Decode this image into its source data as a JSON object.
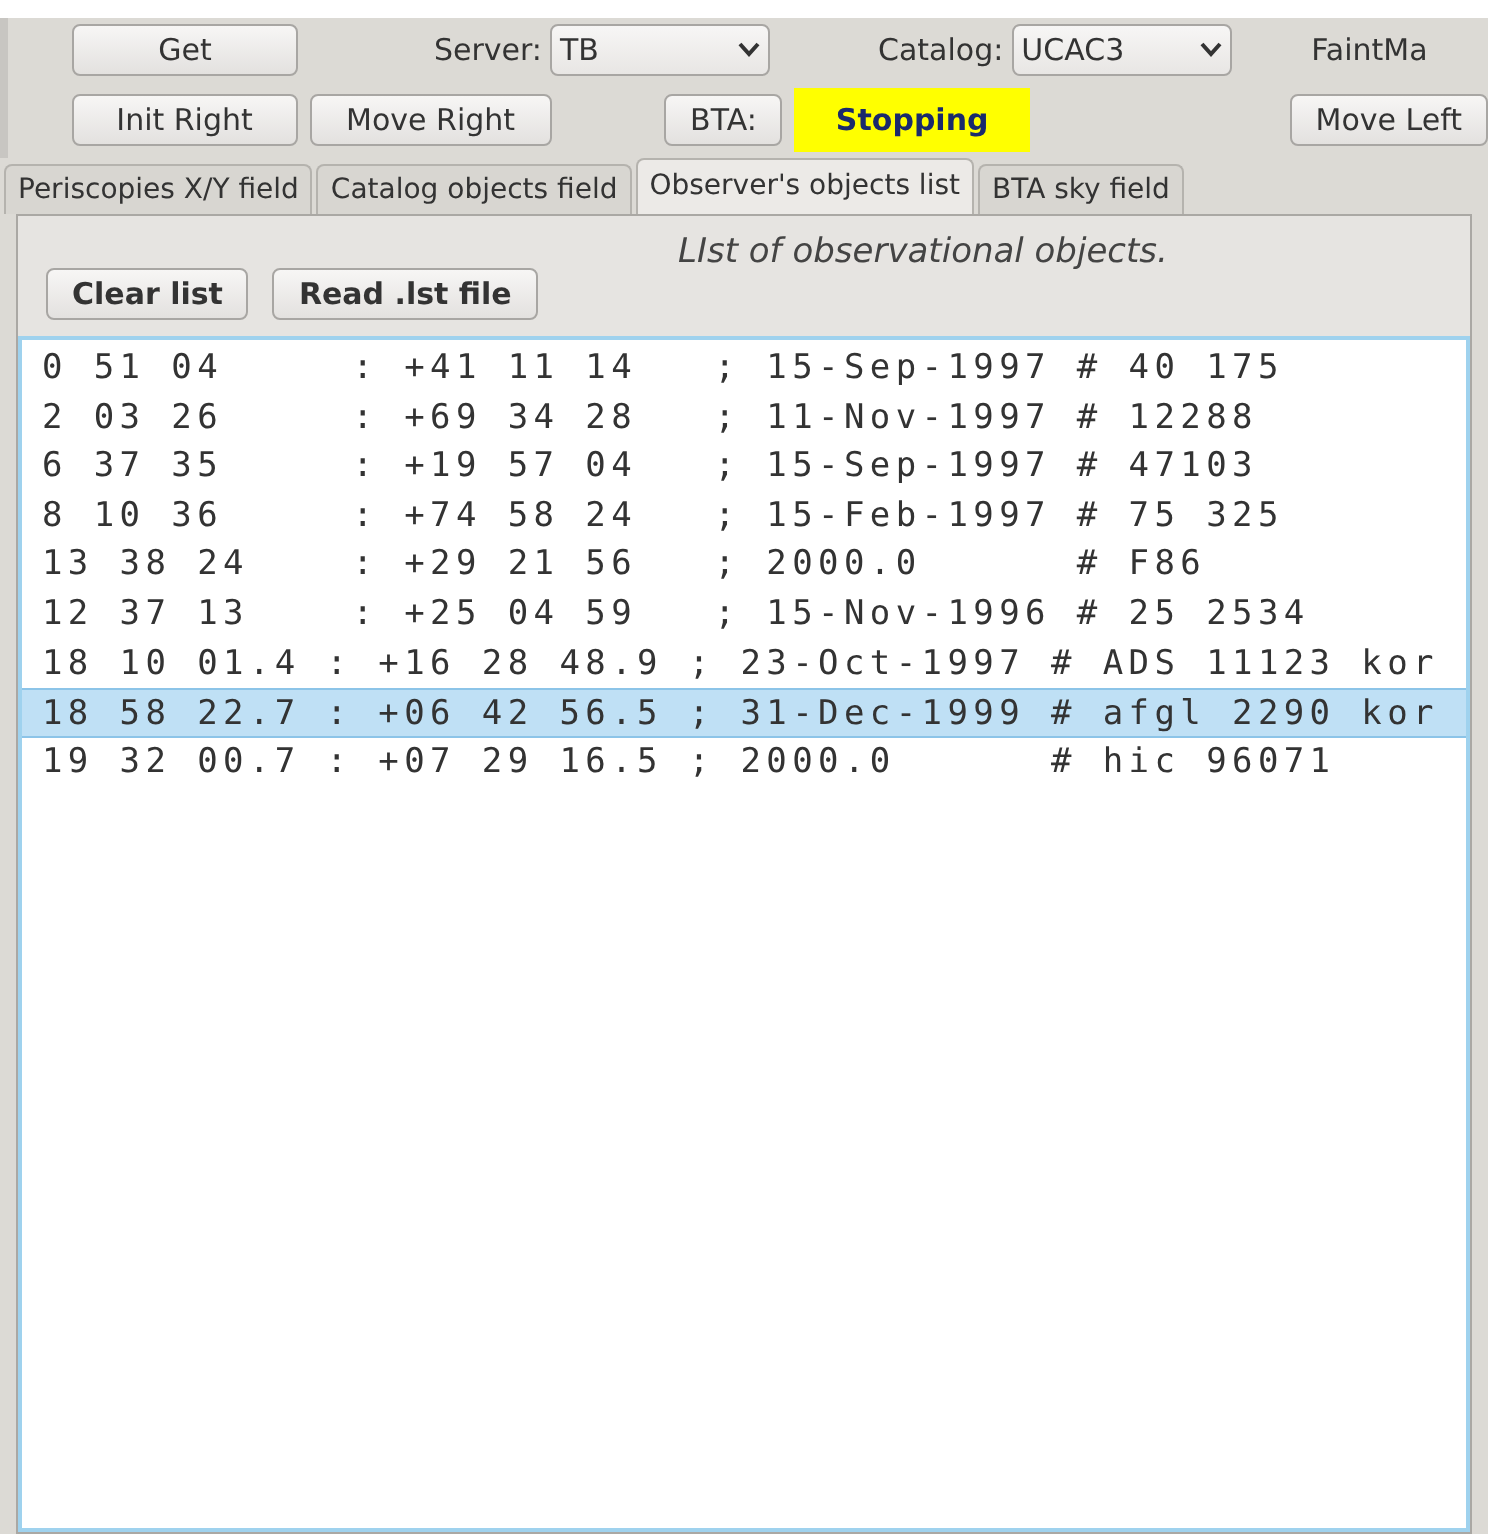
{
  "toolbar": {
    "get_button": "Get",
    "server_label": "Server:",
    "server_value": "TB",
    "catalog_label": "Catalog:",
    "catalog_value": "UCAC3",
    "faint_label": "FaintMa",
    "init_right": "Init Right",
    "move_right": "Move Right",
    "bta_button": "BTA:",
    "bta_status": "Stopping",
    "move_left": "Move Left"
  },
  "tabs": [
    {
      "label": "Periscopies X/Y field",
      "selected": false
    },
    {
      "label": "Catalog objects field",
      "selected": false
    },
    {
      "label": "Observer's objects list",
      "selected": true
    },
    {
      "label": "BTA sky field",
      "selected": false
    }
  ],
  "panel": {
    "title": "LIst of observational objects.",
    "buttons": [
      "Clear list",
      "Read .lst file"
    ]
  },
  "list": [
    {
      "text": "0 51 04     : +41 11 14   ; 15-Sep-1997 # 40 175",
      "selected": false
    },
    {
      "text": "2 03 26     : +69 34 28   ; 11-Nov-1997 # 12288",
      "selected": false
    },
    {
      "text": "6 37 35     : +19 57 04   ; 15-Sep-1997 # 47103",
      "selected": false
    },
    {
      "text": "8 10 36     : +74 58 24   ; 15-Feb-1997 # 75 325",
      "selected": false
    },
    {
      "text": "13 38 24    : +29 21 56   ; 2000.0      # F86",
      "selected": false
    },
    {
      "text": "12 37 13    : +25 04 59   ; 15-Nov-1996 # 25 2534",
      "selected": false
    },
    {
      "text": "18 10 01.4 : +16 28 48.9 ; 23-Oct-1997 # ADS 11123 kor",
      "selected": false
    },
    {
      "text": "18 58 22.7 : +06 42 56.5 ; 31-Dec-1999 # afgl 2290 kor",
      "selected": true
    },
    {
      "text": "19 32 00.7 : +07 29 16.5 ; 2000.0      # hic 96071",
      "selected": false
    }
  ]
}
